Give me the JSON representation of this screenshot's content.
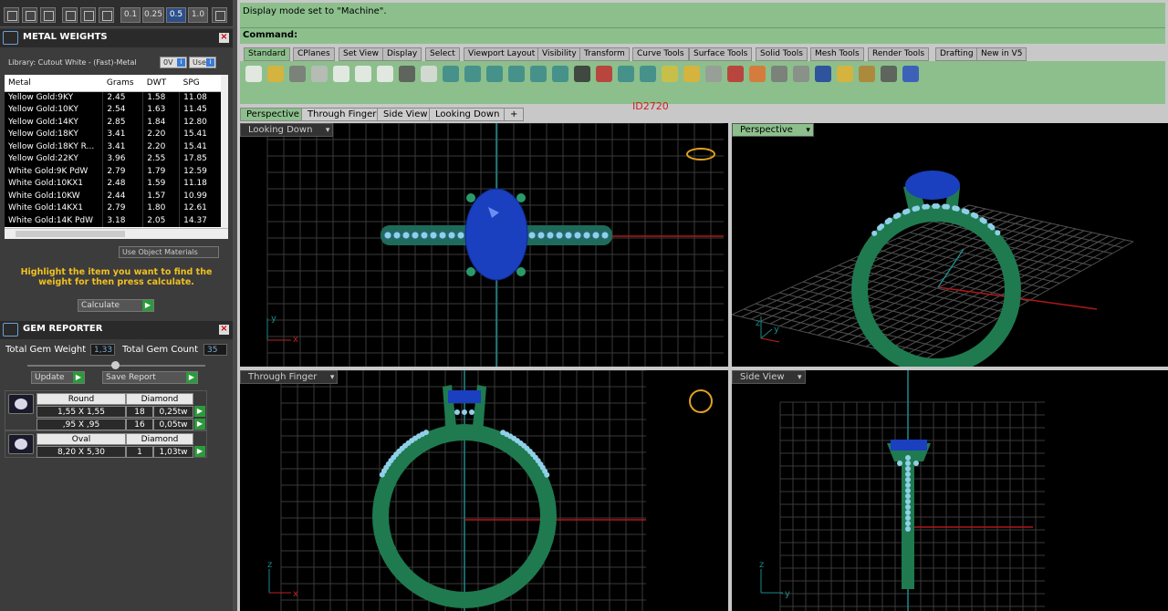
{
  "toolbar_top": {
    "nums": [
      "0.1",
      "0.25",
      "0.5",
      "1.0"
    ]
  },
  "metal_panel": {
    "title": "METAL WEIGHTS",
    "library": "Library: Cutout White - (Fast)-Metal",
    "unit_label": "0V",
    "user_label": "User",
    "columns": [
      "Metal",
      "Grams",
      "DWT",
      "SPG"
    ],
    "rows": [
      [
        "Yellow Gold:9KY",
        "2.45",
        "1.58",
        "11.08"
      ],
      [
        "Yellow Gold:10KY",
        "2.54",
        "1.63",
        "11.45"
      ],
      [
        "Yellow Gold:14KY",
        "2.85",
        "1.84",
        "12.80"
      ],
      [
        "Yellow Gold:18KY",
        "3.41",
        "2.20",
        "15.41"
      ],
      [
        "Yellow Gold:18KY R...",
        "3.41",
        "2.20",
        "15.41"
      ],
      [
        "Yellow Gold:22KY",
        "3.96",
        "2.55",
        "17.85"
      ],
      [
        "White Gold:9K PdW",
        "2.79",
        "1.79",
        "12.59"
      ],
      [
        "White Gold:10KX1",
        "2.48",
        "1.59",
        "11.18"
      ],
      [
        "White Gold:10KW",
        "2.44",
        "1.57",
        "10.99"
      ],
      [
        "White Gold:14KX1",
        "2.79",
        "1.80",
        "12.61"
      ],
      [
        "White Gold:14K PdW",
        "3.18",
        "2.05",
        "14.37"
      ]
    ],
    "use_object_materials": "Use Object Materials",
    "hint": "Highlight the item you want to find the weight for then press calculate.",
    "calculate": "Calculate"
  },
  "gem_panel": {
    "title": "GEM REPORTER",
    "total_weight_label": "Total Gem Weight",
    "total_weight": "1,33",
    "total_count_label": "Total Gem Count",
    "total_count": "35",
    "update": "Update",
    "save_report": "Save Report",
    "gems": [
      {
        "shape": "Round",
        "material": "Diamond",
        "lines": [
          [
            "1,55 X 1,55",
            "18",
            "0,25tw"
          ],
          [
            ",95 X ,95",
            "16",
            "0,05tw"
          ]
        ]
      },
      {
        "shape": "Oval",
        "material": "Diamond",
        "lines": [
          [
            "8,20 X 5,30",
            "1",
            "1,03tw"
          ]
        ]
      }
    ]
  },
  "command": {
    "history": "Display mode set to \"Machine\".",
    "prompt": "Command:"
  },
  "tabs": [
    "Standard",
    "CPlanes",
    "Set View",
    "Display",
    "Select",
    "Viewport Layout",
    "Visibility",
    "Transform",
    "Curve Tools",
    "Surface Tools",
    "Solid Tools",
    "Mesh Tools",
    "Render Tools",
    "Drafting",
    "New in V5"
  ],
  "id_label": "ID2720",
  "view_tabs": [
    "Perspective",
    "Through Finger",
    "Side View",
    "Looking Down",
    "+"
  ],
  "viewports": {
    "top_left": "Looking Down",
    "top_right": "Perspective",
    "bottom_left": "Through Finger",
    "bottom_right": "Side View"
  },
  "axis": {
    "x": "x",
    "y": "y",
    "z": "z"
  },
  "colors": {
    "metal": "#1f7a4f",
    "gem": "#1a3fbf",
    "accent": "#8cbf8c"
  }
}
